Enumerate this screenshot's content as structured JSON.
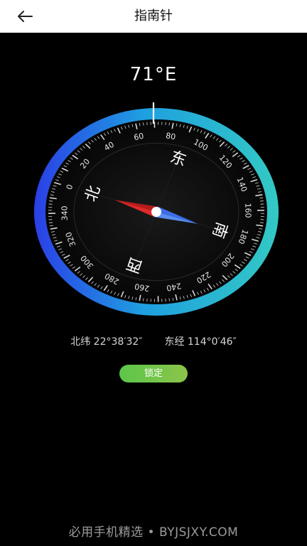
{
  "header": {
    "title": "指南针",
    "back_icon": "arrow-left-icon"
  },
  "compass": {
    "heading_text": "71°E",
    "heading_degrees": 71,
    "ring_colors": [
      "#1f9fe0",
      "#2a3fe6",
      "#33c9c4"
    ],
    "needle_north_color": "#e02a2a",
    "needle_south_color": "#3b6fe8",
    "cardinals": {
      "north": "北",
      "east": "东",
      "south": "南",
      "west": "西"
    },
    "degree_labels": [
      "0",
      "20",
      "40",
      "60",
      "80",
      "100",
      "120",
      "140",
      "160",
      "180",
      "200",
      "220",
      "240",
      "260",
      "280",
      "300",
      "320",
      "340"
    ]
  },
  "location": {
    "latitude": "北纬 22°38′32″",
    "longitude": "东经 114°0′46″"
  },
  "lock_button": {
    "label": "锁定",
    "color": "#6cc34b"
  },
  "watermark": {
    "text": "必用手机精选 • BYJSJXY.COM"
  }
}
